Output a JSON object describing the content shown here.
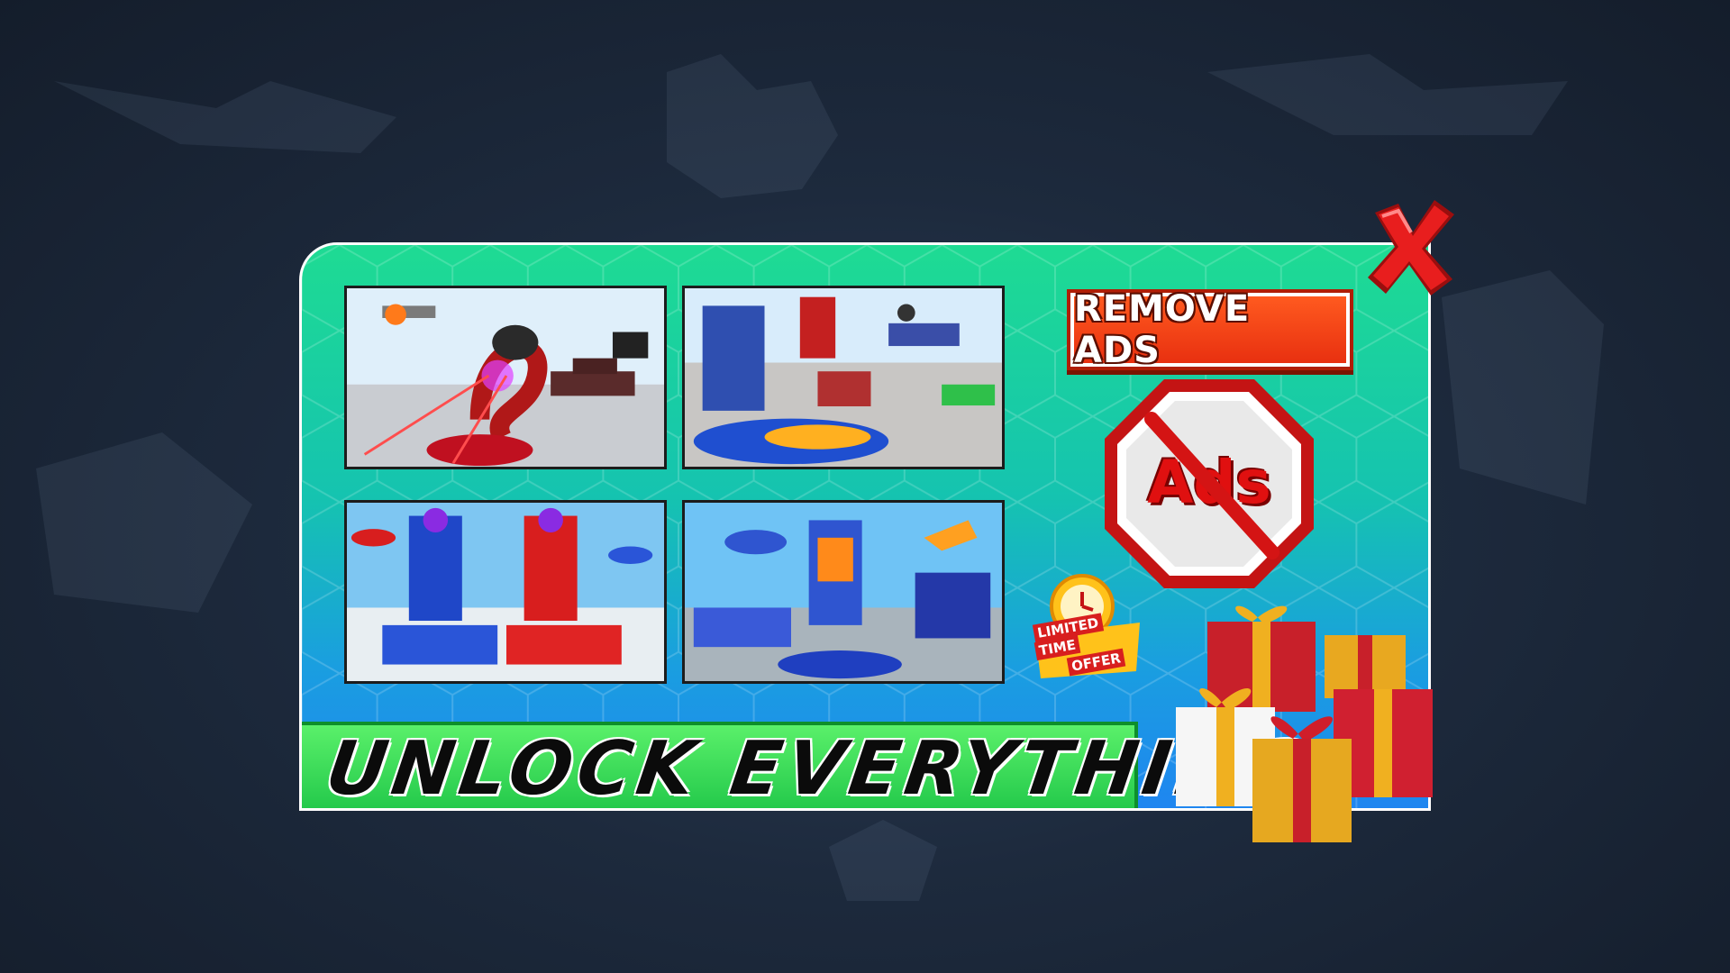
{
  "banner": {
    "remove_ads_label": "REMOVE ADS",
    "no_ads_text": "Ads",
    "unlock_text": "UNLOCK EVERYTHING",
    "offer_badge": {
      "line1": "LIMITED",
      "line2": "TIME",
      "line3": "OFFER"
    }
  },
  "screenshots": [
    {
      "name": "snake-robot-battle"
    },
    {
      "name": "robot-car-transform"
    },
    {
      "name": "tank-robots-face-off"
    },
    {
      "name": "robot-car-helicopter-truck"
    }
  ],
  "colors": {
    "panel_top": "#1edb93",
    "panel_bottom": "#1f86f0",
    "remove_ads_bg": "#e83010",
    "unlock_bar": "#22c84a",
    "close_icon": "#e01e1e"
  },
  "icons": [
    "close-icon",
    "no-ads-icon",
    "limited-offer-badge-icon",
    "gift-boxes-icon"
  ]
}
